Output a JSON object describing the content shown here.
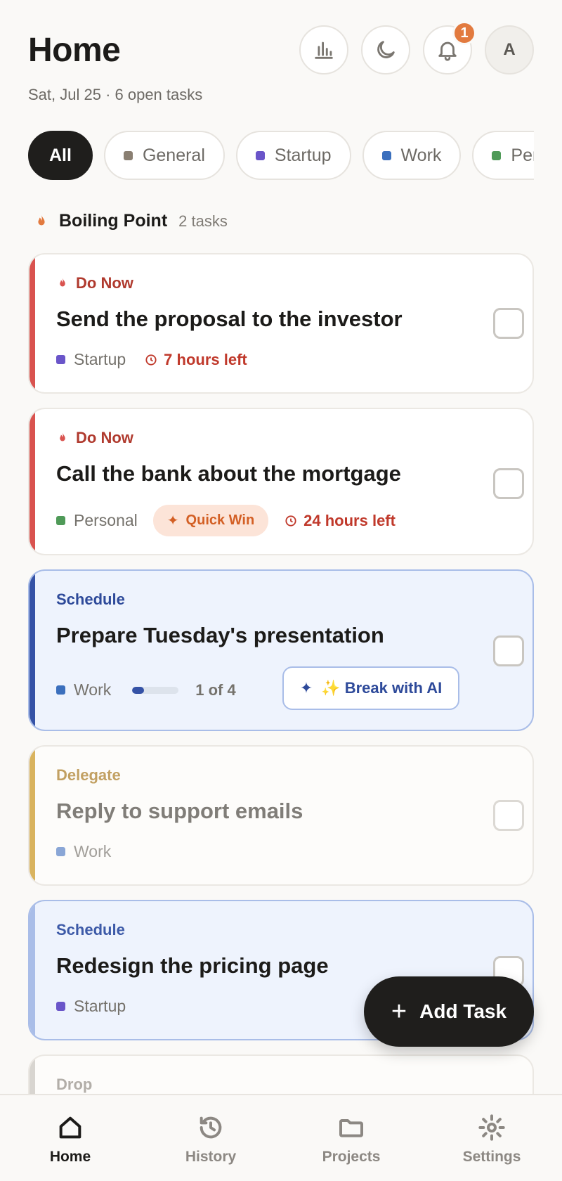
{
  "header": {
    "title": "Home",
    "subtitle": "Sat, Jul 25 · 6 open tasks",
    "notification_count": "1",
    "avatar_initial": "A",
    "icons": [
      "stats-icon",
      "moon-icon",
      "bell-icon"
    ]
  },
  "filters": [
    {
      "label": "All",
      "active": true
    },
    {
      "label": "General",
      "color": "#8a7f72"
    },
    {
      "label": "Startup",
      "color": "#6a55c9"
    },
    {
      "label": "Work",
      "color": "#3b6fbd"
    },
    {
      "label": "Pers",
      "color": "#4f9a58"
    }
  ],
  "section": {
    "title": "Boiling Point",
    "count": "2 tasks"
  },
  "tasks": [
    {
      "label": "Do Now",
      "title": "Send the proposal to the investor",
      "project": "Startup",
      "time_left": "7 hours left"
    },
    {
      "label": "Do Now",
      "title": "Call the bank about the mortgage",
      "project": "Personal",
      "badge": "Quick Win",
      "time_left": "24 hours left"
    },
    {
      "label": "Schedule",
      "title": "Prepare Tuesday's presentation",
      "project": "Work",
      "progress_text": "1 of 4",
      "progress_fraction": 0.25,
      "ai_button": "✨ Break with AI"
    },
    {
      "label": "Delegate",
      "title": "Reply to support emails",
      "project": "Work"
    },
    {
      "label": "Schedule",
      "title": "Redesign the pricing page",
      "project": "Startup"
    },
    {
      "label": "Drop"
    }
  ],
  "fab": {
    "label": "Add Task"
  },
  "nav": [
    {
      "label": "Home",
      "active": true
    },
    {
      "label": "History"
    },
    {
      "label": "Projects"
    },
    {
      "label": "Settings"
    }
  ],
  "colors": {
    "do_now": "#d9534f",
    "schedule": "#3552a6",
    "delegate": "#d9b35e",
    "accent_orange": "#e27a3f"
  }
}
